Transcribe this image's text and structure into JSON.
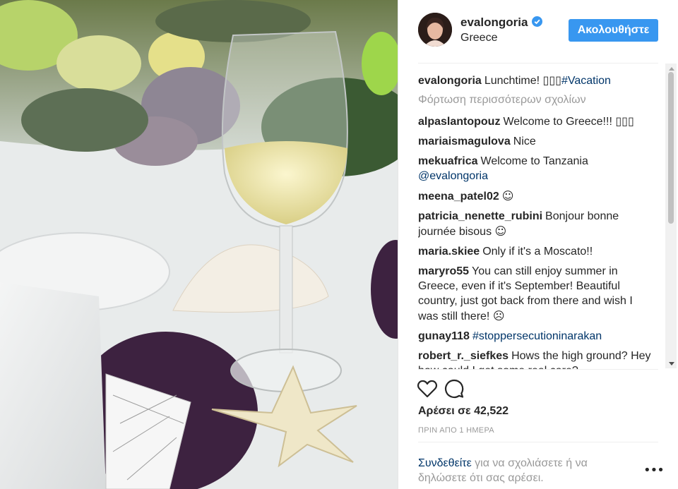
{
  "header": {
    "username": "evalongoria",
    "verified": true,
    "location": "Greece",
    "follow_label": "Ακολουθήστε"
  },
  "caption": {
    "user": "evalongoria",
    "text": "Lunchtime! ",
    "emoji": "▯▯▯",
    "hashtag": "#Vacation"
  },
  "load_more_label": "Φόρτωση περισσότερων σχολίων",
  "comments": [
    {
      "user": "alpaslantopouz",
      "text": "Welcome to Greece!!! ",
      "emoji": "▯▯▯"
    },
    {
      "user": "mariaismagulova",
      "text": "Nice"
    },
    {
      "user": "mekuafrica",
      "text": "Welcome to Tanzania ",
      "mention": "@evalongoria"
    },
    {
      "user": "meena_patel02",
      "emoji": "☺"
    },
    {
      "user": "patricia_nenette_rubini",
      "text": "Bonjour bonne journée bisous ",
      "emoji": "☺"
    },
    {
      "user": "maria.skiee",
      "text": "Only if it's a Moscato!!"
    },
    {
      "user": "maryro55",
      "text": "You can still enjoy summer in Greece, even if it's September! Beautiful country, just got back from there and wish I was still there! ",
      "emoji": "☹"
    },
    {
      "user": "gunay118",
      "hashtag": "#stoppersecutioninarakan"
    },
    {
      "user": "robert_r._siefkes",
      "text": "Hows the high ground? Hey how could I get some real care?"
    }
  ],
  "icons": {
    "like": "heart-icon",
    "comment": "comment-bubble-icon",
    "verified": "verified-badge-icon",
    "more": "ellipsis-icon"
  },
  "likes_label": "Αρέσει σε 42,522",
  "timestamp": "ΠΡΙΝ ΑΠΟ 1 ΗΜΕΡΑ",
  "footer": {
    "login_link": "Συνδεθείτε",
    "prompt_text": " για να σχολιάσετε ή να δηλώσετε ότι σας αρέσει.",
    "more_label": "•••"
  },
  "colors": {
    "accent": "#3897f0",
    "link": "#003569",
    "muted": "#999999",
    "text": "#262626"
  }
}
